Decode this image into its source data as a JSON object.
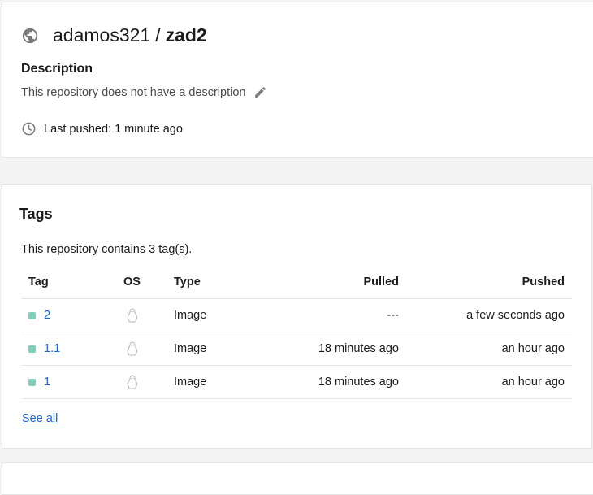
{
  "repo": {
    "namespace": "adamos321",
    "separator": "/",
    "name": "zad2",
    "description_label": "Description",
    "description_text": "This repository does not have a description",
    "last_pushed": "Last pushed: 1 minute ago"
  },
  "tags": {
    "title": "Tags",
    "count_text": "This repository contains 3 tag(s).",
    "columns": {
      "tag": "Tag",
      "os": "OS",
      "type": "Type",
      "pulled": "Pulled",
      "pushed": "Pushed"
    },
    "rows": [
      {
        "tag": "2",
        "os": "linux-icon",
        "type": "Image",
        "pulled": "---",
        "pushed": "a few seconds ago"
      },
      {
        "tag": "1.1",
        "os": "linux-icon",
        "type": "Image",
        "pulled": "18 minutes ago",
        "pushed": "an hour ago"
      },
      {
        "tag": "1",
        "os": "linux-icon",
        "type": "Image",
        "pulled": "18 minutes ago",
        "pushed": "an hour ago"
      }
    ],
    "see_all": "See all"
  },
  "colors": {
    "link": "#1f66d1",
    "tag_dot": "#7ed0b8",
    "icon_gray": "#7a7a7a"
  }
}
